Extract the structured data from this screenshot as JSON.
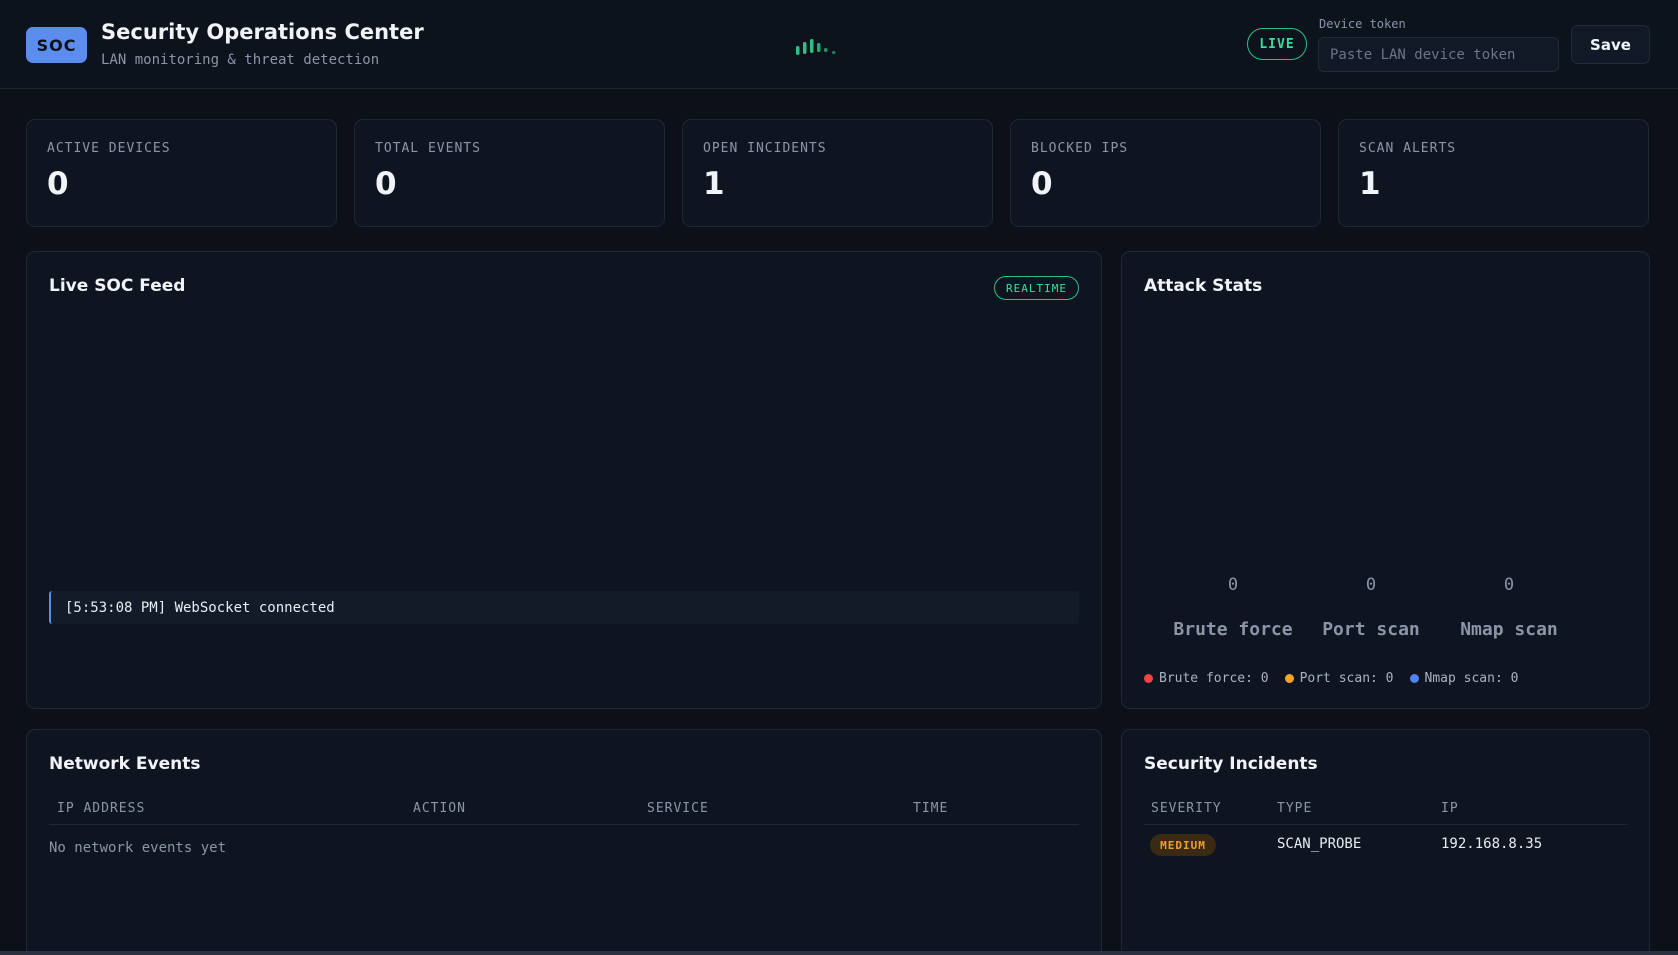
{
  "header": {
    "logo": "SOC",
    "title": "Security Operations Center",
    "subtitle": "LAN monitoring & threat detection",
    "live_badge": "LIVE",
    "token_label": "Device token",
    "token_placeholder": "Paste LAN device token",
    "token_value": "",
    "save_label": "Save"
  },
  "stats": [
    {
      "label": "ACTIVE DEVICES",
      "value": "0"
    },
    {
      "label": "TOTAL EVENTS",
      "value": "0"
    },
    {
      "label": "OPEN INCIDENTS",
      "value": "1"
    },
    {
      "label": "BLOCKED IPS",
      "value": "0"
    },
    {
      "label": "SCAN ALERTS",
      "value": "1"
    }
  ],
  "feed": {
    "title": "Live SOC Feed",
    "badge": "REALTIME",
    "entries": [
      "[5:53:08 PM] WebSocket connected"
    ]
  },
  "attack_stats": {
    "title": "Attack Stats",
    "bars": [
      {
        "label": "Brute force",
        "value": "0"
      },
      {
        "label": "Port scan",
        "value": "0"
      },
      {
        "label": "Nmap scan",
        "value": "0"
      }
    ],
    "legend": [
      {
        "text": "Brute force: 0",
        "color": "#ef4444"
      },
      {
        "text": "Port scan: 0",
        "color": "#f5a524"
      },
      {
        "text": "Nmap scan: 0",
        "color": "#4f83f5"
      }
    ]
  },
  "network_events": {
    "title": "Network Events",
    "columns": [
      "IP ADDRESS",
      "ACTION",
      "SERVICE",
      "TIME"
    ],
    "empty": "No network events yet"
  },
  "incidents": {
    "title": "Security Incidents",
    "columns": [
      "SEVERITY",
      "TYPE",
      "IP"
    ],
    "rows": [
      {
        "severity": "MEDIUM",
        "type": "SCAN_PROBE",
        "ip": "192.168.8.35"
      }
    ]
  },
  "colors": {
    "accent": "#5b8def",
    "live": "#3ddc97",
    "medium": "#f0a030"
  }
}
